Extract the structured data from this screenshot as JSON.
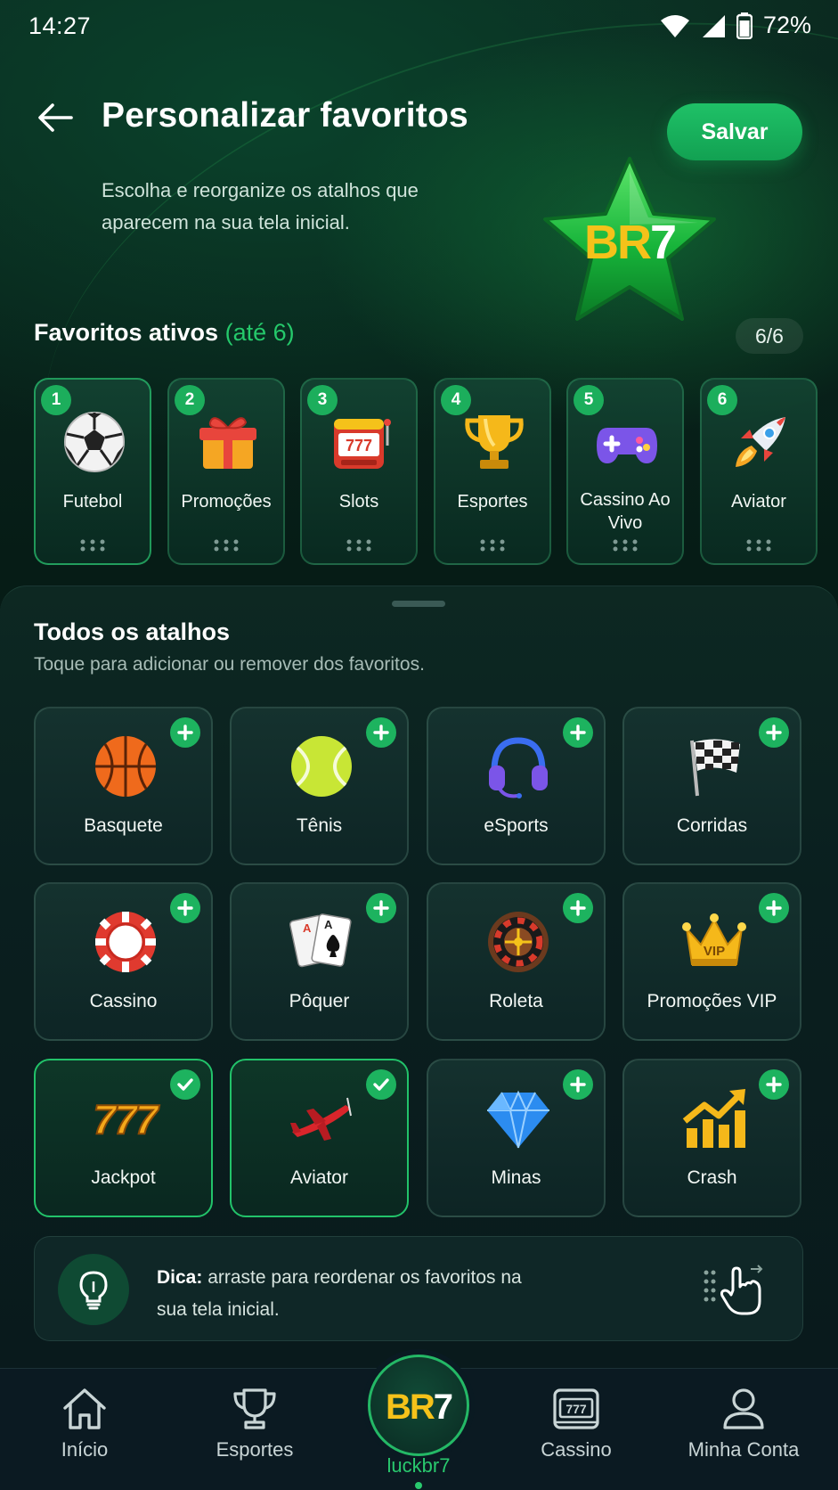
{
  "status_bar": {
    "time": "14:27",
    "battery": "72%"
  },
  "header": {
    "title": "Personalizar favoritos",
    "description": "Escolha e reorganize os atalhos que aparecem na sua tela inicial.",
    "save_label": "Salvar",
    "brand": "BR7"
  },
  "favorites": {
    "title": "Favoritos ativos",
    "limit_note": "(até 6)",
    "count": "6/6",
    "items": [
      {
        "num": "1",
        "label": "Futebol",
        "icon": "soccer-ball-icon"
      },
      {
        "num": "2",
        "label": "Promoções",
        "icon": "gift-icon"
      },
      {
        "num": "3",
        "label": "Slots",
        "icon": "slot-machine-icon"
      },
      {
        "num": "4",
        "label": "Esportes",
        "icon": "trophy-icon"
      },
      {
        "num": "5",
        "label": "Cassino Ao Vivo",
        "icon": "gamepad-icon"
      },
      {
        "num": "6",
        "label": "Aviator",
        "icon": "rocket-icon"
      }
    ]
  },
  "shortcuts": {
    "title": "Todos os atalhos",
    "subtitle": "Toque para adicionar ou remover dos favoritos.",
    "items": [
      {
        "label": "Basquete",
        "icon": "basketball-icon",
        "selected": false
      },
      {
        "label": "Tênis",
        "icon": "tennis-ball-icon",
        "selected": false
      },
      {
        "label": "eSports",
        "icon": "headset-icon",
        "selected": false
      },
      {
        "label": "Corridas",
        "icon": "checkered-flag-icon",
        "selected": false
      },
      {
        "label": "Cassino",
        "icon": "casino-chip-icon",
        "selected": false
      },
      {
        "label": "Pôquer",
        "icon": "playing-cards-icon",
        "selected": false
      },
      {
        "label": "Roleta",
        "icon": "roulette-icon",
        "selected": false
      },
      {
        "label": "Promoções VIP",
        "icon": "vip-crown-icon",
        "selected": false
      },
      {
        "label": "Jackpot",
        "icon": "jackpot-777-icon",
        "selected": true
      },
      {
        "label": "Aviator",
        "icon": "airplane-icon",
        "selected": true
      },
      {
        "label": "Minas",
        "icon": "diamond-icon",
        "selected": false
      },
      {
        "label": "Crash",
        "icon": "chart-arrow-icon",
        "selected": false
      }
    ]
  },
  "tip": {
    "prefix": "Dica:",
    "text": " arraste para reordenar os favoritos na sua tela inicial."
  },
  "bottom_nav": {
    "items": [
      {
        "label": "Início",
        "icon": "home-icon"
      },
      {
        "label": "Esportes",
        "icon": "trophy-outline-icon"
      },
      {
        "label": "luckbr7",
        "icon": "br7-logo-icon",
        "active": true
      },
      {
        "label": "Cassino",
        "icon": "slot-outline-icon"
      },
      {
        "label": "Minha Conta",
        "icon": "user-icon"
      }
    ]
  },
  "colors": {
    "accent": "#1fc167",
    "background": "#061c16",
    "gold": "#f5c21a"
  }
}
